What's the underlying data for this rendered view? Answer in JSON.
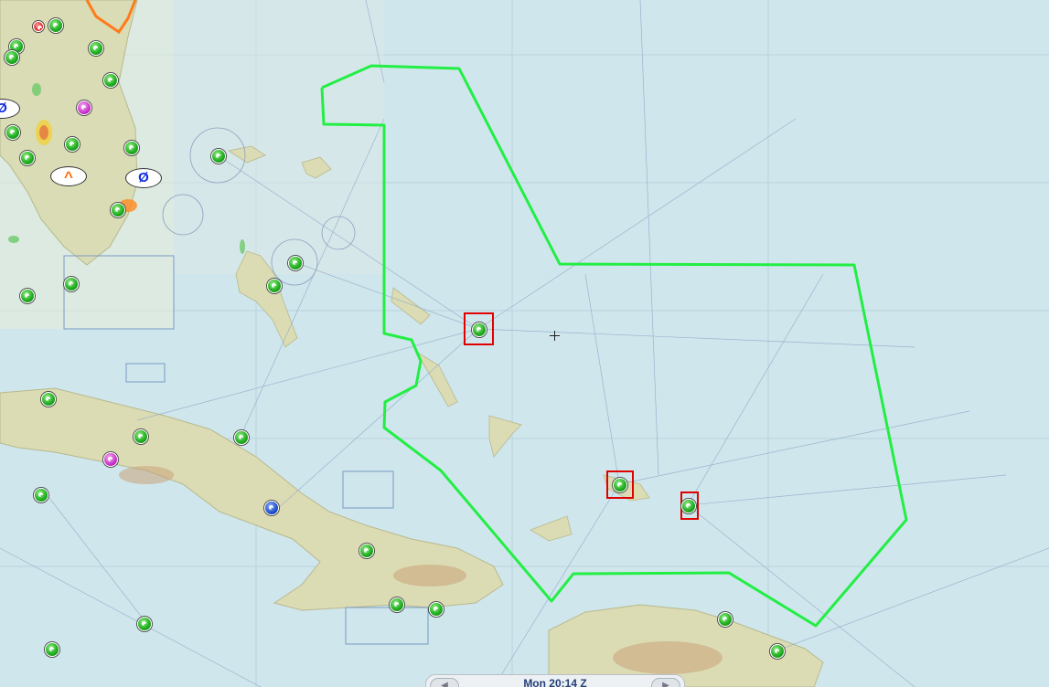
{
  "map": {
    "boundary_color": "#22ee44",
    "highlight_color": "#e00000",
    "sea_color": "#cfe6ec",
    "land_color": "#dcdcb4"
  },
  "weather_bubbles": [
    {
      "id": "overcast-1",
      "symbol": "Ø"
    },
    {
      "id": "overcast-2",
      "symbol": "Ø"
    },
    {
      "id": "overcast-3",
      "symbol": "^"
    }
  ],
  "status_bar": {
    "time_label": "Mon 20:14 Z",
    "prev_icon": "play-left-icon",
    "next_icon": "play-right-icon"
  }
}
